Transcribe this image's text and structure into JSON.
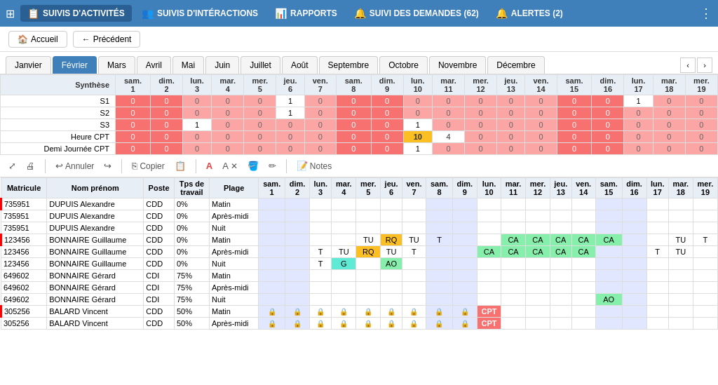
{
  "topNav": {
    "gridIcon": "⊞",
    "items": [
      {
        "id": "activites",
        "label": "SUIVIS D'ACTIVITÉS",
        "icon": "📋",
        "active": true
      },
      {
        "id": "interactions",
        "label": "SUIVIS D'INTÉRACTIONS",
        "icon": "👥",
        "active": false
      },
      {
        "id": "rapports",
        "label": "RAPPORTS",
        "icon": "📊",
        "active": false
      },
      {
        "id": "demandes",
        "label": "SUIVI DES DEMANDES (62)",
        "icon": "🔔",
        "active": false
      },
      {
        "id": "alertes",
        "label": "ALERTES (2)",
        "icon": "🔔",
        "active": false
      }
    ],
    "moreBtn": "⋮"
  },
  "secondBar": {
    "homeIcon": "🏠",
    "accueilLabel": "Accueil",
    "arrowIcon": "←",
    "precedentLabel": "Précédent"
  },
  "months": {
    "tabs": [
      "Janvier",
      "Février",
      "Mars",
      "Avril",
      "Mai",
      "Juin",
      "Juillet",
      "Août",
      "Septembre",
      "Octobre",
      "Novembre",
      "Décembre"
    ],
    "activeIndex": 1
  },
  "synthesis": {
    "headerDays": [
      "sam.\n1",
      "dim.\n2",
      "lun.\n3",
      "mar.\n4",
      "mer.\n5",
      "jeu.\n6",
      "ven.\n7",
      "sam.\n8",
      "dim.\n9",
      "lun.\n10",
      "mar.\n11",
      "mer.\n12",
      "jeu.\n13",
      "ven.\n14",
      "sam.\n15",
      "dim.\n16",
      "lun.\n17",
      "mar.\n18",
      "mer.\n19"
    ],
    "rows": [
      {
        "label": "Synthèse",
        "isHeader": true
      },
      {
        "label": "S1",
        "values": [
          "0",
          "0",
          "0",
          "0",
          "0",
          "1",
          "0",
          "0",
          "0",
          "0",
          "0",
          "0",
          "0",
          "0",
          "0",
          "0",
          "1",
          "0",
          "0"
        ]
      },
      {
        "label": "S2",
        "values": [
          "0",
          "0",
          "0",
          "0",
          "0",
          "1",
          "0",
          "0",
          "0",
          "0",
          "0",
          "0",
          "0",
          "0",
          "0",
          "0",
          "0",
          "0",
          "0"
        ]
      },
      {
        "label": "S3",
        "values": [
          "0",
          "0",
          "1",
          "0",
          "0",
          "0",
          "0",
          "0",
          "0",
          "1",
          "0",
          "0",
          "0",
          "0",
          "0",
          "0",
          "0",
          "0",
          "0"
        ]
      },
      {
        "label": "Heure CPT",
        "values": [
          "0",
          "0",
          "0",
          "0",
          "0",
          "0",
          "0",
          "0",
          "0",
          "10",
          "4",
          "0",
          "0",
          "0",
          "0",
          "0",
          "0",
          "0",
          "0"
        ]
      },
      {
        "label": "Demi Journée CPT",
        "values": [
          "0",
          "0",
          "0",
          "0",
          "0",
          "0",
          "0",
          "0",
          "0",
          "1",
          "0",
          "0",
          "0",
          "0",
          "0",
          "0",
          "0",
          "0",
          "0"
        ]
      }
    ]
  },
  "toolbar": {
    "expandIcon": "⤢",
    "printIcon": "🖨",
    "undoIcon": "↩",
    "undoLabel": "Annuler",
    "redoIcon": "↪",
    "copyIcon": "⎘",
    "copyLabel": "Copier",
    "pasteIcon": "📋",
    "fontIcon": "A",
    "clearIcon": "✕",
    "bucketIcon": "🪣",
    "penIcon": "✏",
    "notesIcon": "📝",
    "notesLabel": "Notes"
  },
  "mainTable": {
    "columns": [
      "Matricule",
      "Nom prénom",
      "Poste",
      "Tps de travail",
      "Plage",
      "sam.\n1",
      "dim.\n2",
      "lun.\n3",
      "mar.\n4",
      "mer.\n5",
      "jeu.\n6",
      "ven.\n7",
      "sam.\n8",
      "dim.\n9",
      "lun.\n10",
      "mar.\n11",
      "mer.\n12",
      "jeu.\n13",
      "ven.\n14",
      "sam.\n15",
      "dim.\n16",
      "lun.\n17",
      "mar.\n18",
      "mer.\n19"
    ],
    "rows": [
      {
        "matricule": "735951",
        "nom": "DUPUIS Alexandre",
        "poste": "CDD",
        "tps": "0%",
        "plage": "Matin",
        "redBorder": true,
        "cells": [
          "",
          "",
          "",
          "",
          "",
          "",
          "",
          "",
          "",
          "",
          "",
          "",
          "",
          "",
          "",
          "",
          "",
          "",
          ""
        ]
      },
      {
        "matricule": "735951",
        "nom": "DUPUIS Alexandre",
        "poste": "CDD",
        "tps": "0%",
        "plage": "Après-midi",
        "redBorder": false,
        "cells": [
          "",
          "",
          "",
          "",
          "",
          "",
          "",
          "",
          "",
          "",
          "",
          "",
          "",
          "",
          "",
          "",
          "",
          "",
          ""
        ]
      },
      {
        "matricule": "735951",
        "nom": "DUPUIS Alexandre",
        "poste": "CDD",
        "tps": "0%",
        "plage": "Nuit",
        "redBorder": false,
        "cells": [
          "",
          "",
          "",
          "",
          "",
          "",
          "",
          "",
          "",
          "",
          "",
          "",
          "",
          "",
          "",
          "",
          "",
          "",
          ""
        ]
      },
      {
        "matricule": "123456",
        "nom": "BONNAIRE Guillaume",
        "poste": "CDD",
        "tps": "0%",
        "plage": "Matin",
        "redBorder": true,
        "cells": [
          "",
          "",
          "",
          "",
          "TU",
          "RQ",
          "TU",
          "T",
          "",
          "",
          "CA",
          "CA",
          "CA",
          "CA",
          "CA",
          "",
          "",
          "TU",
          "T"
        ]
      },
      {
        "matricule": "123456",
        "nom": "BONNAIRE Guillaume",
        "poste": "CDD",
        "tps": "0%",
        "plage": "Après-midi",
        "redBorder": false,
        "cells": [
          "",
          "",
          "T",
          "TU",
          "RQ",
          "TU",
          "T",
          "",
          "",
          "CA",
          "CA",
          "CA",
          "CA",
          "CA",
          "",
          "",
          "T",
          "TU",
          ""
        ]
      },
      {
        "matricule": "123456",
        "nom": "BONNAIRE Guillaume",
        "poste": "CDD",
        "tps": "0%",
        "plage": "Nuit",
        "redBorder": false,
        "cells": [
          "",
          "",
          "T",
          "G",
          "",
          "AO",
          "",
          "",
          "",
          "",
          "",
          "",
          "",
          "",
          "",
          "",
          "",
          "",
          ""
        ]
      },
      {
        "matricule": "649602",
        "nom": "BONNAIRE Gérard",
        "poste": "CDI",
        "tps": "75%",
        "plage": "Matin",
        "redBorder": false,
        "cells": [
          "",
          "",
          "",
          "",
          "",
          "",
          "",
          "",
          "",
          "",
          "",
          "",
          "",
          "",
          "",
          "",
          "",
          "",
          ""
        ]
      },
      {
        "matricule": "649602",
        "nom": "BONNAIRE Gérard",
        "poste": "CDI",
        "tps": "75%",
        "plage": "Après-midi",
        "redBorder": false,
        "cells": [
          "",
          "",
          "",
          "",
          "",
          "",
          "",
          "",
          "",
          "",
          "",
          "",
          "",
          "",
          "",
          "",
          "",
          "",
          ""
        ]
      },
      {
        "matricule": "649602",
        "nom": "BONNAIRE Gérard",
        "poste": "CDI",
        "tps": "75%",
        "plage": "Nuit",
        "redBorder": false,
        "cells": [
          "",
          "",
          "",
          "",
          "",
          "",
          "",
          "",
          "",
          "",
          "",
          "",
          "",
          "",
          "AO",
          "",
          "",
          "",
          ""
        ]
      },
      {
        "matricule": "305256",
        "nom": "BALARD Vincent",
        "poste": "CDD",
        "tps": "50%",
        "plage": "Matin",
        "redBorder": true,
        "cells": [
          "🔒",
          "🔒",
          "🔒",
          "🔒",
          "🔒",
          "🔒",
          "🔒",
          "🔒",
          "🔒",
          "CPT",
          "",
          "",
          "",
          "",
          "",
          "",
          "",
          "",
          ""
        ]
      },
      {
        "matricule": "305256",
        "nom": "BALARD Vincent",
        "poste": "CDD",
        "tps": "50%",
        "plage": "Après-midi",
        "redBorder": false,
        "cells": [
          "🔒",
          "🔒",
          "🔒",
          "🔒",
          "🔒",
          "🔒",
          "🔒",
          "🔒",
          "🔒",
          "CPT",
          "",
          "",
          "",
          "",
          "",
          "",
          "",
          "",
          ""
        ]
      }
    ]
  }
}
